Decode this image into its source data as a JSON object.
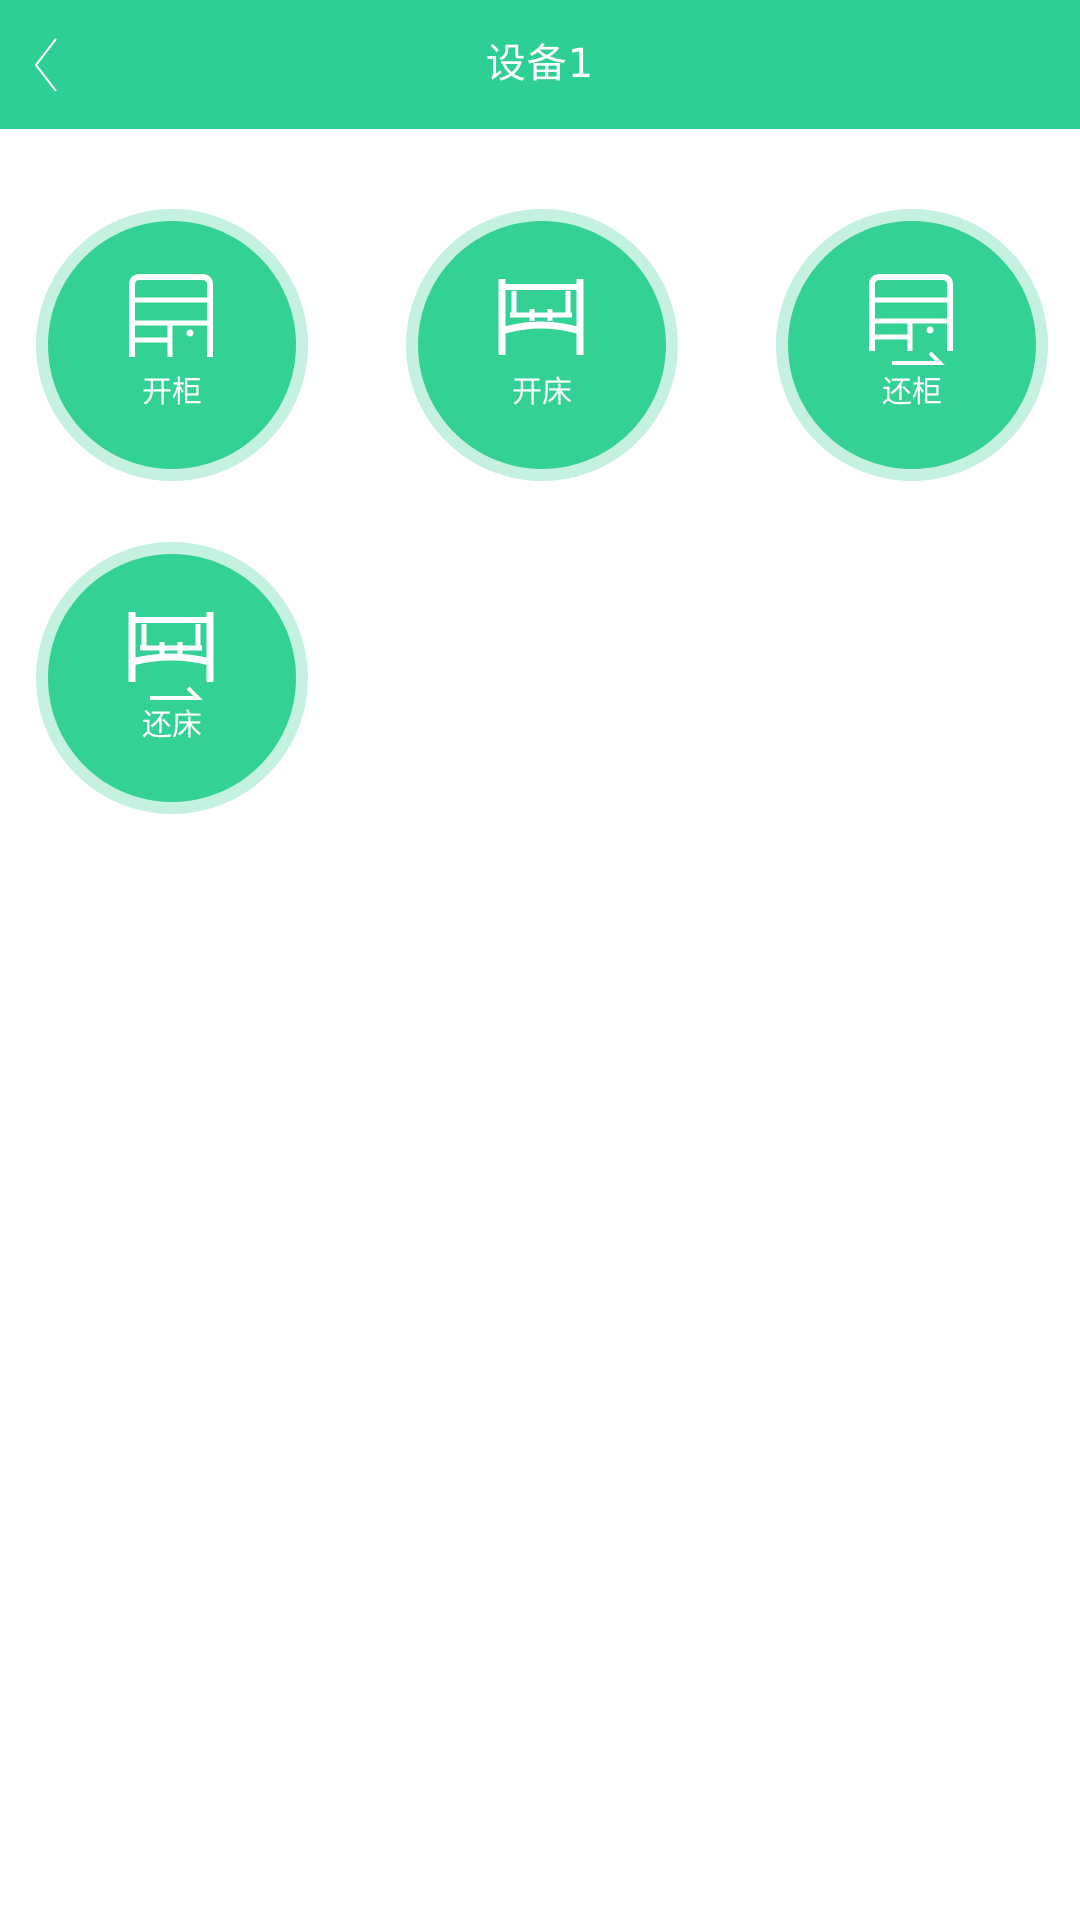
{
  "header": {
    "title": "设备1",
    "back_icon": "chevron-left-icon",
    "color": "#2ecf93"
  },
  "actions": [
    {
      "label": "开柜",
      "icon": "cabinet-icon"
    },
    {
      "label": "开床",
      "icon": "bed-icon"
    },
    {
      "label": "还柜",
      "icon": "return-cabinet-icon"
    },
    {
      "label": "还床",
      "icon": "return-bed-icon"
    }
  ],
  "colors": {
    "circle": "#34d194",
    "ring": "#c4f1e0"
  }
}
